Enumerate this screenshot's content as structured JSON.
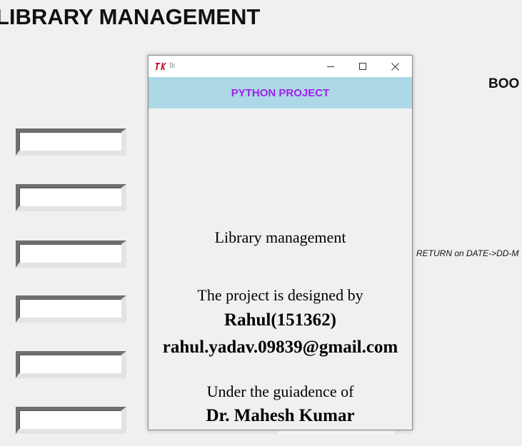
{
  "main_window": {
    "title": "LIBRARY MANAGEMENT",
    "books_heading": "BOO",
    "return_hint": "RETURN on DATE->DD-M"
  },
  "popup": {
    "window_title": "tk",
    "banner": "PYTHON PROJECT",
    "banner_bg": "#add8e6",
    "banner_color": "#a020f0",
    "heading": "Library management",
    "designed_by_label": "The project is designed by",
    "author": "Rahul(151362)",
    "email": "rahul.yadav.09839@gmail.com",
    "guidance_label": "Under the guiadence of",
    "guide": "Dr. Mahesh Kumar"
  },
  "icons": {
    "app": "tk-feather-logo",
    "minimize": "minimize-icon",
    "maximize": "maximize-icon",
    "close": "close-icon"
  }
}
